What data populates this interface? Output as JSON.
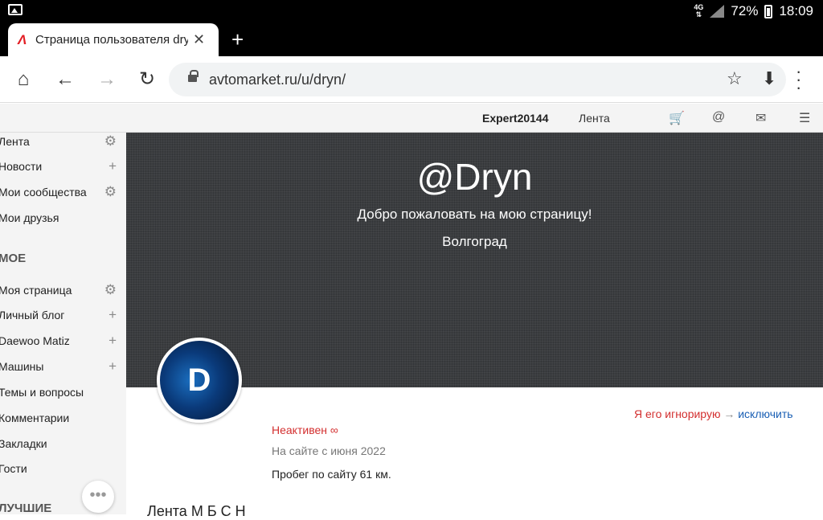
{
  "status_bar": {
    "network": "4G",
    "battery": "72%",
    "time": "18:09"
  },
  "browser": {
    "tab_title": "Страница пользователя dry",
    "tab_favicon": "Λ",
    "new_tab": "+",
    "url": "avtomarket.ru/u/dryn/"
  },
  "site_header": {
    "username": "Expert20144",
    "feed_link": "Лента"
  },
  "sidebar": {
    "top": [
      {
        "label": "Лента",
        "action": "⚙"
      },
      {
        "label": "Новости",
        "action": "+"
      },
      {
        "label": "Мои сообщества",
        "action": "⚙"
      },
      {
        "label": "Мои друзья",
        "action": ""
      }
    ],
    "section_mine": "МОЕ",
    "mine": [
      {
        "label": "Моя страница",
        "action": "⚙"
      },
      {
        "label": "Личный блог",
        "action": "+"
      },
      {
        "label": "Daewoo Matiz",
        "action": "+"
      },
      {
        "label": "Машины",
        "action": "+"
      },
      {
        "label": "Темы и вопросы",
        "action": ""
      },
      {
        "label": "Комментарии",
        "action": ""
      },
      {
        "label": "Закладки",
        "action": ""
      },
      {
        "label": "Гости",
        "action": ""
      }
    ],
    "section_best": "ЛУЧШИЕ"
  },
  "profile": {
    "nick": "@Dryn",
    "greeting": "Добро пожаловать на мою страницу!",
    "city": "Волгоград",
    "avatar_letter": "D",
    "ignore_text": "Я его игнорирую",
    "ignore_arrow": "→",
    "exclude_link": "исключить",
    "status": "Неактивен ∞",
    "since": "На сайте с июня 2022",
    "mileage": "Пробег по сайту 61 км.",
    "tabs_partial": "Лента    М          Б       С                Н"
  }
}
